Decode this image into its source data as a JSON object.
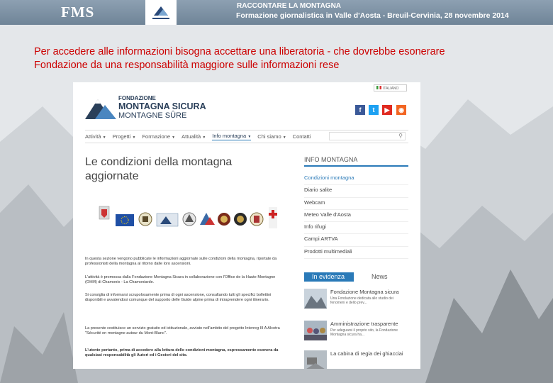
{
  "header": {
    "brand": "FMS",
    "title": "RACCONTARE LA MONTAGNA",
    "subtitle": "Formazione giornalistica in Valle d'Aosta - Breuil-Cervinia, 28 novembre 2014"
  },
  "caption": {
    "line1": "Per accedere alle informazioni bisogna accettare una liberatoria - che dovrebbe esonerare",
    "line2": "Fondazione da una responsabilità maggiore sulle informazioni rese"
  },
  "site": {
    "language": "ITALIANO",
    "logo": {
      "line1": "FONDAZIONE",
      "line2": "MONTAGNA SICURA",
      "line3": "MONTAGNE SÛRE"
    },
    "social": [
      {
        "name": "facebook",
        "glyph": "f",
        "color": "#3b5998"
      },
      {
        "name": "twitter",
        "glyph": "t",
        "color": "#1da1f2"
      },
      {
        "name": "youtube",
        "glyph": "▶",
        "color": "#e02a20"
      },
      {
        "name": "rss",
        "glyph": "◉",
        "color": "#f26522"
      }
    ],
    "nav": [
      {
        "label": "Attività",
        "caret": "▼"
      },
      {
        "label": "Progetti",
        "caret": "▼"
      },
      {
        "label": "Formazione",
        "caret": "▼"
      },
      {
        "label": "Attualità",
        "caret": "▼"
      },
      {
        "label": "Info montagna",
        "caret": "▼"
      },
      {
        "label": "Chi siamo",
        "caret": "▼"
      },
      {
        "label": "Contatti",
        "caret": ""
      }
    ],
    "search_icon": "⚲",
    "page_title_line1": "Le condizioni della montagna",
    "page_title_line2": "aggiornate",
    "paragraphs": [
      "In questa sezione vengono pubblicate le informazioni aggiornate sulle condizioni della montagna, riportate da professionisti della montagna al ritorno dalle loro ascensioni.",
      "L'attività è promossa dalla Fondazione Montagna Sicura in collaborazione con l'Office de la Haute Montagne (OHM) di Chamonix - La Chamoniarde.",
      "Si consiglia di informarsi scrupolosamente prima di ogni ascensione, consultando tutti gli specifici bollettini disponibili e avvalendosi comunque del supporto delle Guide alpine prima di intraprendere ogni itinerario.",
      "La presente costituisce un servizio gratuito ed istituzionale, avviato nell'ambito del progetto Interreg III A Alcotra \"Sécurité en montagne autour du Mont-Blanc\".",
      "L'utente pertanto, prima di accedere alla lettura delle condizioni montagna, espressamente esonera da qualsiasi responsabilità gli Autori ed i Gestori del sito."
    ],
    "sidebar": {
      "title": "INFO MONTAGNA",
      "items": [
        "Condizioni montagna",
        "Diario salite",
        "Webcam",
        "Meteo Valle d'Aosta",
        "Info rifugi",
        "Campi ARTVA",
        "Prodotti multimediali"
      ]
    },
    "tabs": {
      "active": "In evidenza",
      "other": "News"
    },
    "news": [
      {
        "title": "Fondazione Montagna sicura",
        "summary": "Una Fondazione dedicata allo studio dei fenomeni e dello prev..."
      },
      {
        "title": "Amministrazione trasparente",
        "summary": "Per adeguarsi il proprio sito, la Fondazione Montagna sicura ha..."
      },
      {
        "title": "La cabina di regia dei ghiacciai",
        "summary": ""
      }
    ]
  },
  "colors": {
    "accent": "#2a7ab8",
    "caption": "#cc0000",
    "header": "#7a8ea1"
  }
}
